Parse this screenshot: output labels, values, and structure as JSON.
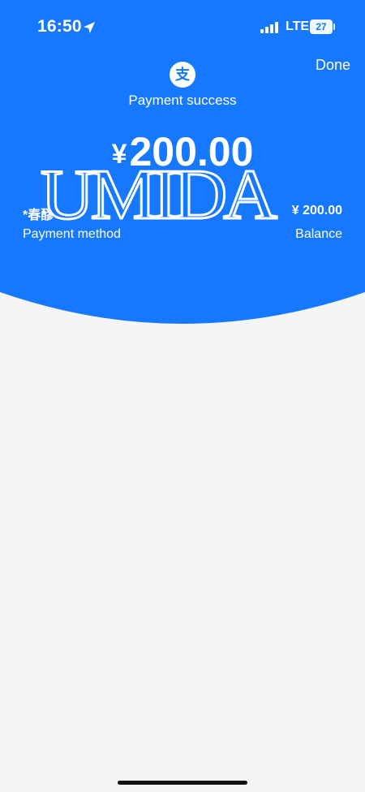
{
  "status_bar": {
    "time": "16:50",
    "network": "LTE",
    "battery": "27",
    "location_icon": "location-arrow-icon",
    "signal_icon": "signal-bars-icon",
    "battery_icon": "battery-icon"
  },
  "header": {
    "done_label": "Done",
    "logo_icon": "alipay-icon",
    "title": "Payment success"
  },
  "payment": {
    "currency": "¥",
    "amount": "200.00",
    "method_value": "*春醪",
    "method_label": "Payment method",
    "balance_value": "¥ 200.00",
    "balance_label": "Balance"
  },
  "overlay": {
    "watermark_text": "UMIDA"
  },
  "colors": {
    "header_blue": "#1677ff",
    "background": "#f5f5f5",
    "text": "#ffffff",
    "home_indicator": "#111111"
  }
}
